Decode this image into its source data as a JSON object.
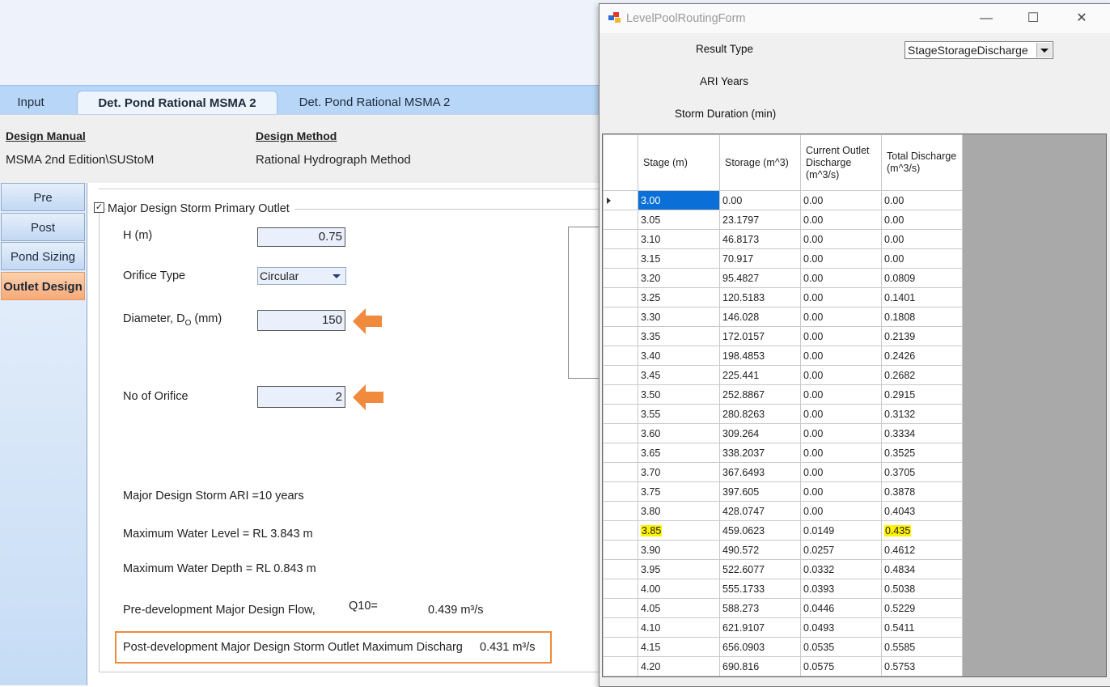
{
  "main": {
    "tabs": [
      "Input",
      "Det. Pond Rational MSMA 2",
      "Det. Pond Rational MSMA 2"
    ],
    "info": {
      "manual_label": "Design Manual",
      "manual_value": "MSMA 2nd Edition\\SUStoM",
      "method_label": "Design Method",
      "method_value": "Rational Hydrograph Method"
    },
    "nav": [
      "Pre",
      "Post",
      "Pond Sizing",
      "Outlet Design"
    ],
    "group_title": "Major Design Storm Primary Outlet",
    "fields": {
      "h_label": "H (m)",
      "h_value": "0.75",
      "orifice_type_label": "Orifice Type",
      "orifice_type_value": "Circular",
      "diameter_label_pre": "Diameter, D",
      "diameter_label_sub": "O",
      "diameter_label_post": " (mm)",
      "diameter_value": "150",
      "no_orifice_label": "No of Orifice",
      "no_orifice_value": "2"
    },
    "results": {
      "ari": "Major Design Storm ARI =10 years",
      "max_level": "Maximum Water Level =  RL 3.843 m",
      "max_depth": "Maximum Water Depth =  RL 0.843 m",
      "predev_label": "Pre-development Major Design Flow,",
      "predev_q": "Q10=",
      "predev_value": "0.439 m³/s",
      "postdev_label": "Post-development Major Design Storm Outlet Maximum Discharg",
      "postdev_value": "0.431 m³/s"
    },
    "colors": {
      "accent_orange": "#f08a3c",
      "tab_blue": "#b8d6f7"
    }
  },
  "window": {
    "title": "LevelPoolRoutingForm",
    "result_type_label": "Result Type",
    "result_type_value": "StageStorageDischarge",
    "ari_label": "ARI Years",
    "duration_label": "Storm Duration (min)",
    "columns": [
      "Stage (m)",
      "Storage (m^3)",
      "Current Outlet Discharge (m^3/s)",
      "Total Discharge (m^3/s)"
    ],
    "rows": [
      [
        "3.00",
        "0.00",
        "0.00",
        "0.00"
      ],
      [
        "3.05",
        "23.1797",
        "0.00",
        "0.00"
      ],
      [
        "3.10",
        "46.8173",
        "0.00",
        "0.00"
      ],
      [
        "3.15",
        "70.917",
        "0.00",
        "0.00"
      ],
      [
        "3.20",
        "95.4827",
        "0.00",
        "0.0809"
      ],
      [
        "3.25",
        "120.5183",
        "0.00",
        "0.1401"
      ],
      [
        "3.30",
        "146.028",
        "0.00",
        "0.1808"
      ],
      [
        "3.35",
        "172.0157",
        "0.00",
        "0.2139"
      ],
      [
        "3.40",
        "198.4853",
        "0.00",
        "0.2426"
      ],
      [
        "3.45",
        "225.441",
        "0.00",
        "0.2682"
      ],
      [
        "3.50",
        "252.8867",
        "0.00",
        "0.2915"
      ],
      [
        "3.55",
        "280.8263",
        "0.00",
        "0.3132"
      ],
      [
        "3.60",
        "309.264",
        "0.00",
        "0.3334"
      ],
      [
        "3.65",
        "338.2037",
        "0.00",
        "0.3525"
      ],
      [
        "3.70",
        "367.6493",
        "0.00",
        "0.3705"
      ],
      [
        "3.75",
        "397.605",
        "0.00",
        "0.3878"
      ],
      [
        "3.80",
        "428.0747",
        "0.00",
        "0.4043"
      ],
      [
        "3.85",
        "459.0623",
        "0.0149",
        "0.435"
      ],
      [
        "3.90",
        "490.572",
        "0.0257",
        "0.4612"
      ],
      [
        "3.95",
        "522.6077",
        "0.0332",
        "0.4834"
      ],
      [
        "4.00",
        "555.1733",
        "0.0393",
        "0.5038"
      ],
      [
        "4.05",
        "588.273",
        "0.0446",
        "0.5229"
      ],
      [
        "4.10",
        "621.9107",
        "0.0493",
        "0.5411"
      ],
      [
        "4.15",
        "656.0903",
        "0.0535",
        "0.5585"
      ],
      [
        "4.20",
        "690.816",
        "0.0575",
        "0.5753"
      ]
    ],
    "selected_row": 0,
    "highlighted_row": 17
  }
}
